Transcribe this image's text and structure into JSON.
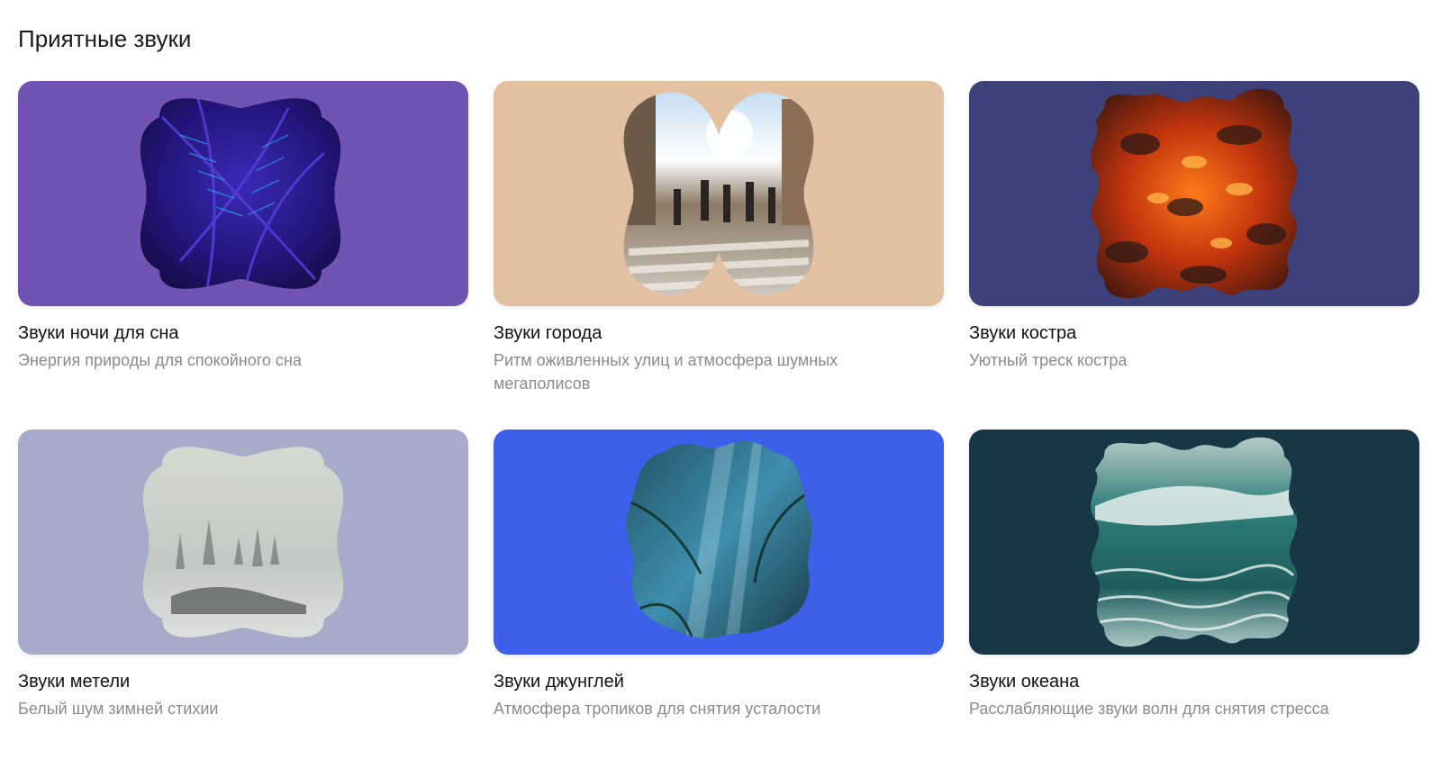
{
  "section": {
    "title": "Приятные звуки"
  },
  "cards": [
    {
      "title": "Звуки ночи для сна",
      "subtitle": "Энергия природы для спокойного сна",
      "bg": "#7053b3",
      "icon": "palm-leaves-night-image"
    },
    {
      "title": "Звуки города",
      "subtitle": "Ритм оживленных улиц и атмосфера шумных мегаполисов",
      "bg": "#e2c0a1",
      "icon": "city-street-image"
    },
    {
      "title": "Звуки костра",
      "subtitle": "Уютный треск костра",
      "bg": "#3c417a",
      "icon": "glowing-embers-image"
    },
    {
      "title": "Звуки метели",
      "subtitle": "Белый шум зимней стихии",
      "bg": "#a6abc9",
      "icon": "snowstorm-trees-image"
    },
    {
      "title": "Звуки джунглей",
      "subtitle": "Атмосфера тропиков для снятия усталости",
      "bg": "#3d5fea",
      "icon": "jungle-sunrays-image"
    },
    {
      "title": "Звуки океана",
      "subtitle": "Расслабляющие звуки волн для снятия стресса",
      "bg": "#183746",
      "icon": "ocean-wave-image"
    }
  ]
}
